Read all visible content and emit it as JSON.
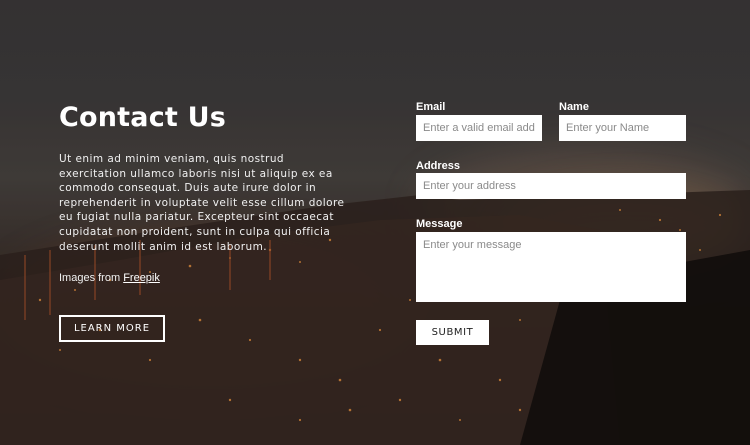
{
  "hero": {
    "title": "Contact Us",
    "description": "Ut enim ad minim veniam, quis nostrud exercitation ullamco laboris nisi ut aliquip ex ea commodo consequat. Duis aute irure dolor in reprehenderit in voluptate velit esse cillum dolore eu fugiat nulla pariatur. Excepteur sint occaecat cupidatat non proident, sunt in culpa qui officia deserunt mollit anim id est laborum.",
    "credit_prefix": "Images from ",
    "credit_link": "Freepik",
    "learn_more_label": "LEARN MORE"
  },
  "form": {
    "email": {
      "label": "Email",
      "placeholder": "Enter a valid email address",
      "value": ""
    },
    "name": {
      "label": "Name",
      "placeholder": "Enter your Name",
      "value": ""
    },
    "address": {
      "label": "Address",
      "placeholder": "Enter your address",
      "value": ""
    },
    "message": {
      "label": "Message",
      "placeholder": "Enter your message",
      "value": ""
    },
    "submit_label": "SUBMIT"
  },
  "colors": {
    "text": "#ffffff",
    "field_background": "#ffffff",
    "placeholder": "#8a8a8a"
  }
}
